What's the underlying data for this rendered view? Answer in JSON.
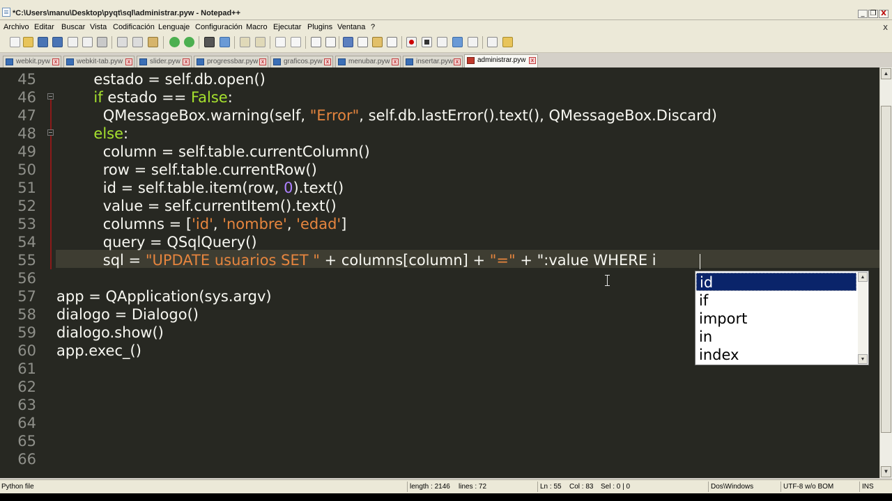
{
  "window": {
    "title": "*C:\\Users\\manu\\Desktop\\pyqt\\sql\\administrar.pyw - Notepad++",
    "minimize_glyph": "_",
    "restore_glyph": "❐",
    "close_glyph": "X"
  },
  "menu": {
    "items": [
      "Archivo",
      "Editar",
      "Buscar",
      "Vista",
      "Codificación",
      "Lenguaje",
      "Configuración",
      "Macro",
      "Ejecutar",
      "Plugins",
      "Ventana",
      "?"
    ],
    "close_document_glyph": "x"
  },
  "toolbar": {
    "icons": [
      "new-file-icon",
      "open-file-icon",
      "save-icon",
      "save-all-icon",
      "close-icon",
      "close-all-icon",
      "print-icon",
      "cut-icon",
      "copy-icon",
      "paste-icon",
      "undo-icon",
      "redo-icon",
      "find-icon",
      "replace-icon",
      "zoom-in-icon",
      "zoom-out-icon",
      "sync-vertical-icon",
      "sync-horizontal-icon",
      "word-wrap-icon",
      "show-all-chars-icon",
      "indent-guide-icon",
      "user-language-icon",
      "doc-map-icon",
      "function-list-icon",
      "record-macro-icon",
      "stop-macro-icon",
      "play-macro-icon",
      "play-multiple-icon",
      "save-macro-icon",
      "spell-check-icon",
      "trim-icon"
    ]
  },
  "tabs": [
    {
      "label": "webkit.pyw",
      "active": false
    },
    {
      "label": "webkit-tab.pyw",
      "active": false
    },
    {
      "label": "slider.pyw",
      "active": false
    },
    {
      "label": "progressbar.pyw",
      "active": false
    },
    {
      "label": "graficos.pyw",
      "active": false
    },
    {
      "label": "menubar.pyw",
      "active": false
    },
    {
      "label": "insertar.pyw",
      "active": false
    },
    {
      "label": "administrar.pyw",
      "active": true
    }
  ],
  "tab_close_glyph": "x",
  "editor": {
    "line_numbers": [
      "45",
      "46",
      "47",
      "48",
      "49",
      "50",
      "51",
      "52",
      "53",
      "54",
      "55",
      "56",
      "57",
      "58",
      "59",
      "60",
      "61",
      "62",
      "63",
      "64",
      "65",
      "66"
    ],
    "current_line": "55",
    "code": [
      [
        {
          "t": "        estado = self.db.open()",
          "c": "p"
        }
      ],
      [
        {
          "t": "        ",
          "c": "p"
        },
        {
          "t": "if",
          "c": "kw"
        },
        {
          "t": " estado == ",
          "c": "p"
        },
        {
          "t": "False",
          "c": "kw"
        },
        {
          "t": ":",
          "c": "p"
        }
      ],
      [
        {
          "t": "          QMessageBox.warning(self, ",
          "c": "p"
        },
        {
          "t": "\"Error\"",
          "c": "str"
        },
        {
          "t": ", self.db.lastError().text(), QMessageBox.Discard)",
          "c": "p"
        }
      ],
      [
        {
          "t": "        ",
          "c": "p"
        },
        {
          "t": "else",
          "c": "kw"
        },
        {
          "t": ":",
          "c": "p"
        }
      ],
      [
        {
          "t": "          column = self.table.currentColumn()",
          "c": "p"
        }
      ],
      [
        {
          "t": "          row = self.table.currentRow()",
          "c": "p"
        }
      ],
      [
        {
          "t": "          id = self.table.item(row, ",
          "c": "p"
        },
        {
          "t": "0",
          "c": "num"
        },
        {
          "t": ").text()",
          "c": "p"
        }
      ],
      [
        {
          "t": "          value = self.currentItem().text()",
          "c": "p"
        }
      ],
      [
        {
          "t": "          columns = [",
          "c": "p"
        },
        {
          "t": "'id'",
          "c": "str"
        },
        {
          "t": ", ",
          "c": "p"
        },
        {
          "t": "'nombre'",
          "c": "str"
        },
        {
          "t": ", ",
          "c": "p"
        },
        {
          "t": "'edad'",
          "c": "str"
        },
        {
          "t": "]",
          "c": "p"
        }
      ],
      [
        {
          "t": "          query = QSqlQuery()",
          "c": "p"
        }
      ],
      [
        {
          "t": "          sql = ",
          "c": "p"
        },
        {
          "t": "\"UPDATE usuarios SET \"",
          "c": "str"
        },
        {
          "t": " + columns[column] + ",
          "c": "p"
        },
        {
          "t": "\"=\"",
          "c": "str"
        },
        {
          "t": " + \":value WHERE i",
          "c": "p"
        }
      ],
      [
        {
          "t": "",
          "c": "p"
        }
      ],
      [
        {
          "t": "app = QApplication(sys.argv)",
          "c": "p"
        }
      ],
      [
        {
          "t": "dialogo = Dialogo()",
          "c": "p"
        }
      ],
      [
        {
          "t": "dialogo.show()",
          "c": "p"
        }
      ],
      [
        {
          "t": "app.exec_()",
          "c": "p"
        }
      ],
      [
        {
          "t": "",
          "c": "p"
        }
      ],
      [
        {
          "t": "",
          "c": "p"
        }
      ],
      [
        {
          "t": "",
          "c": "p"
        }
      ],
      [
        {
          "t": "",
          "c": "p"
        }
      ],
      [
        {
          "t": "",
          "c": "p"
        }
      ],
      [
        {
          "t": "",
          "c": "p"
        }
      ]
    ],
    "colors": {
      "background": "#272822",
      "keyword": "#a6e22e",
      "string": "#e6853e",
      "number": "#ae81ff",
      "text": "#f8f8f2",
      "line_number": "#8f908a"
    }
  },
  "autocomplete": {
    "items": [
      "id",
      "if",
      "import",
      "in",
      "index"
    ],
    "selected": "id",
    "up_glyph": "▲",
    "down_glyph": "▼"
  },
  "scrollbar": {
    "up_glyph": "▲",
    "down_glyph": "▼"
  },
  "status": {
    "file_type": "Python file",
    "length": "length : 2146",
    "lines": "lines : 72",
    "ln": "Ln : 55",
    "col": "Col : 83",
    "sel": "Sel : 0 | 0",
    "eol": "Dos\\Windows",
    "encoding": "UTF-8 w/o BOM",
    "mode": "INS"
  }
}
